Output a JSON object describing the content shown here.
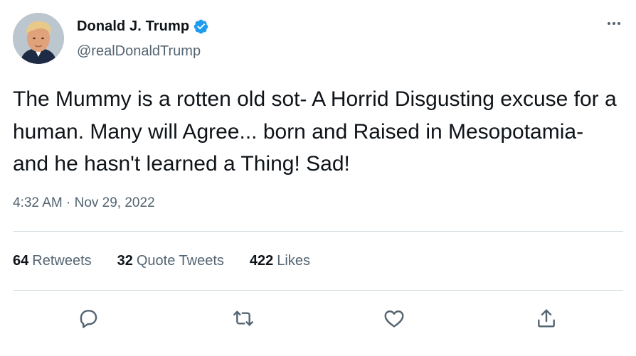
{
  "author": {
    "display_name": "Donald J. Trump",
    "handle": "@realDonaldTrump",
    "verified": true,
    "verified_color": "#1d9bf0"
  },
  "tweet": {
    "text": "The Mummy is a rotten old sot- A Horrid Disgusting excuse for a human. Many will Agree... born and Raised in Mesopotamia- and he hasn't learned a Thing! Sad!",
    "time": "4:32 AM",
    "separator": "·",
    "date": "Nov 29, 2022"
  },
  "stats": {
    "retweets": {
      "count": "64",
      "label": "Retweets"
    },
    "quotes": {
      "count": "32",
      "label": "Quote Tweets"
    },
    "likes": {
      "count": "422",
      "label": "Likes"
    }
  },
  "actions": [
    "reply-icon",
    "retweet-icon",
    "like-icon",
    "share-icon"
  ],
  "menu_icon": "more-icon",
  "colors": {
    "text": "#0f1419",
    "secondary": "#536471",
    "divider": "#cfd9de"
  }
}
